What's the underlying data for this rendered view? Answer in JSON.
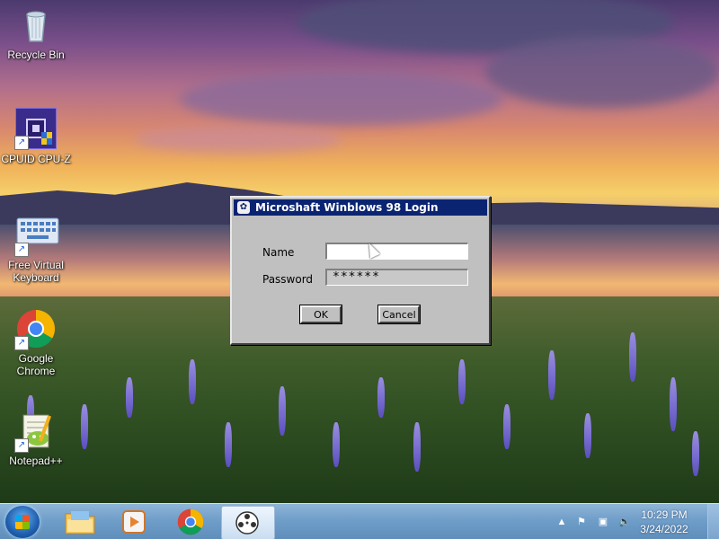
{
  "desktop_icons": [
    {
      "label": "Recycle Bin",
      "icon": "recycle-bin-icon"
    },
    {
      "label": "CPUID CPU-Z",
      "icon": "cpuz-icon"
    },
    {
      "label": "Free Virtual Keyboard",
      "icon": "keyboard-icon"
    },
    {
      "label": "Google Chrome",
      "icon": "chrome-icon"
    },
    {
      "label": "Notepad++",
      "icon": "notepadpp-icon"
    }
  ],
  "dialog": {
    "title": "Microshaft Winblows 98 Login",
    "name_label": "Name",
    "name_value": "",
    "password_label": "Password",
    "password_value": "******",
    "ok_label": "OK",
    "cancel_label": "Cancel"
  },
  "taskbar": {
    "pinned": [
      {
        "icon": "file-explorer-icon"
      },
      {
        "icon": "media-player-icon"
      },
      {
        "icon": "chrome-icon"
      },
      {
        "icon": "film-reel-app-icon",
        "active": true
      }
    ],
    "tray": {
      "icons": [
        "show-hidden-icons-chevron",
        "action-center-flag-icon",
        "network-icon",
        "volume-muted-icon"
      ]
    },
    "clock": {
      "time": "10:29 PM",
      "date": "3/24/2022"
    }
  },
  "colors": {
    "titlebar": "#0a2472",
    "dialog_face": "#c0c0c0",
    "taskbar": "#6f9ec9"
  }
}
